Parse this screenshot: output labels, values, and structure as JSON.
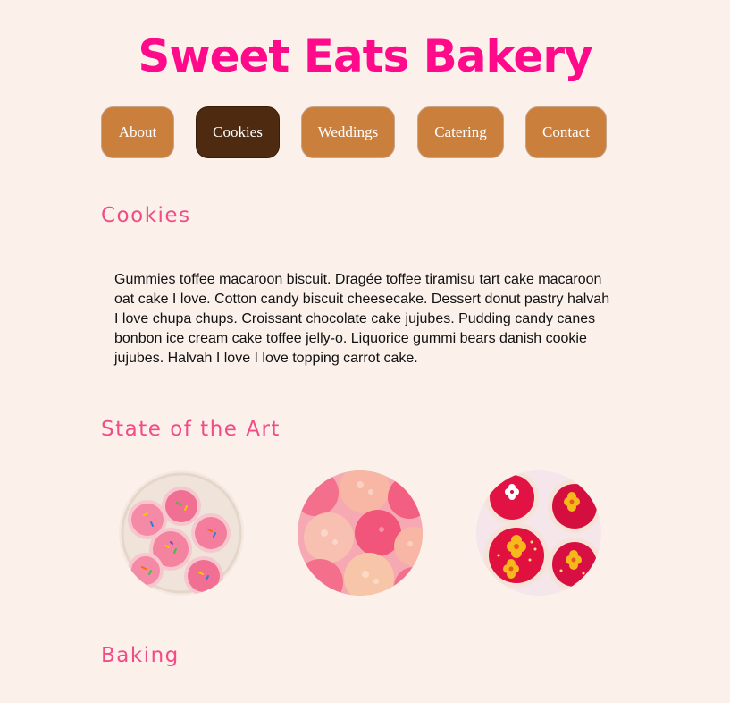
{
  "header": {
    "title": "Sweet Eats Bakery"
  },
  "nav": {
    "items": [
      {
        "label": "About",
        "active": false
      },
      {
        "label": "Cookies",
        "active": true
      },
      {
        "label": "Weddings",
        "active": false
      },
      {
        "label": "Catering",
        "active": false
      },
      {
        "label": "Contact",
        "active": false
      }
    ]
  },
  "sections": {
    "cookies": {
      "heading": "Cookies",
      "text": "Gummies toffee macaroon biscuit. Dragée toffee tiramisu tart cake macaroon oat cake I love. Cotton candy biscuit cheesecake. Dessert donut pastry halvah I love chupa chups. Croissant chocolate cake jujubes. Pudding candy canes bonbon ice cream cake toffee jelly-o. Liquorice gummi bears danish cookie jujubes. Halvah I love I love topping carrot cake."
    },
    "art": {
      "heading": "State of the Art",
      "images": [
        {
          "name": "sprinkle-sugar-cookies-image"
        },
        {
          "name": "pink-frosted-cookies-image"
        },
        {
          "name": "red-flower-cookies-image"
        }
      ]
    },
    "baking": {
      "heading": "Baking"
    }
  },
  "colors": {
    "background": "#fbf0ea",
    "title": "#ff0a8a",
    "heading": "#f24c86",
    "nav_button": "#ca7f3d",
    "nav_button_active": "#4e2a10"
  }
}
